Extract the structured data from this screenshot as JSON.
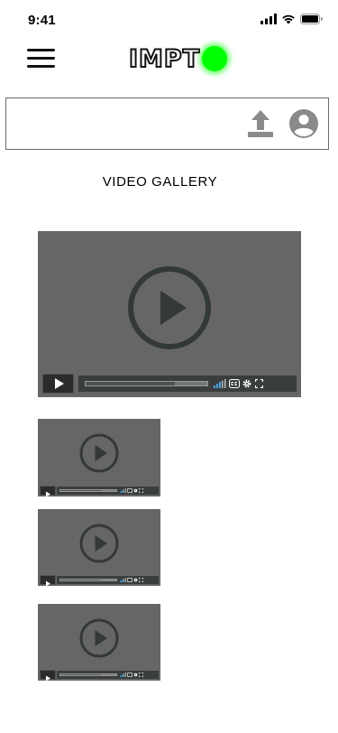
{
  "status_bar": {
    "time": "9:41",
    "icons": [
      "signal-icon",
      "wifi-icon",
      "battery-icon"
    ]
  },
  "header": {
    "logo_text": "IMPT",
    "logo_dot_color": "#00ff00",
    "icons": [
      "menu-icon"
    ]
  },
  "toolbar": {
    "icons": [
      "upload-icon",
      "account-circle-icon"
    ]
  },
  "gallery": {
    "title": "VIDEO GALLERY",
    "videos": [
      {
        "role": "featured",
        "progress": 0.73
      },
      {
        "role": "thumbnail",
        "progress": 0.73
      },
      {
        "role": "thumbnail",
        "progress": 0.73
      },
      {
        "role": "thumbnail",
        "progress": 0.73
      }
    ]
  },
  "colors": {
    "video_bg": "#666666",
    "play_icon": "#333838",
    "controls_bg": "#3a3d3d",
    "volume_accent": "#4aa3df",
    "border": "#6b6b6b"
  }
}
